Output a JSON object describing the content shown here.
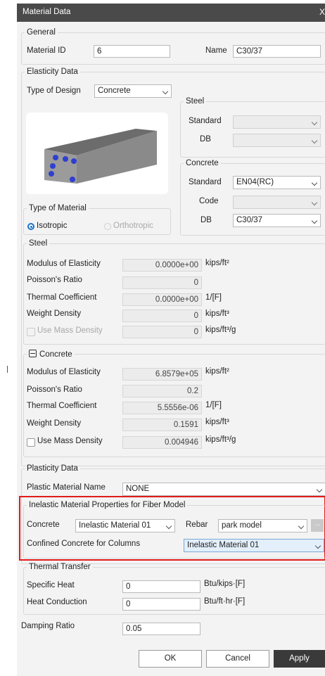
{
  "window": {
    "title": "Material Data",
    "close_label": "X"
  },
  "general": {
    "legend": "General",
    "material_id_label": "Material ID",
    "material_id_value": "6",
    "name_label": "Name",
    "name_value": "C30/37"
  },
  "elasticity": {
    "legend": "Elasticity Data",
    "type_of_design_label": "Type of Design",
    "type_of_design_value": "Concrete",
    "steel_legend": "Steel",
    "steel_standard_label": "Standard",
    "steel_standard_value": "",
    "steel_db_label": "DB",
    "steel_db_value": "",
    "concrete_legend": "Concrete",
    "concrete_standard_label": "Standard",
    "concrete_standard_value": "EN04(RC)",
    "concrete_code_label": "Code",
    "concrete_code_value": "",
    "concrete_db_label": "DB",
    "concrete_db_value": "C30/37",
    "type_of_material_legend": "Type of Material",
    "isotropic_label": "Isotropic",
    "orthotropic_label": "Orthotropic",
    "selected_material_type": "Isotropic"
  },
  "steel_props": {
    "legend": "Steel",
    "modulus_label": "Modulus of Elasticity",
    "modulus_value": "0.0000e+00",
    "modulus_unit": "kips/ft²",
    "poisson_label": "Poisson's Ratio",
    "poisson_value": "0",
    "thermal_label": "Thermal Coefficient",
    "thermal_value": "0.0000e+00",
    "thermal_unit": "1/[F]",
    "weight_label": "Weight Density",
    "weight_value": "0",
    "weight_unit": "kips/ft³",
    "use_mass_label": "Use Mass Density",
    "use_mass_value": "0",
    "use_mass_unit": "kips/ft³/g"
  },
  "concrete_props": {
    "legend": "Concrete",
    "modulus_label": "Modulus of Elasticity",
    "modulus_value": "6.8579e+05",
    "modulus_unit": "kips/ft²",
    "poisson_label": "Poisson's Ratio",
    "poisson_value": "0.2",
    "thermal_label": "Thermal Coefficient",
    "thermal_value": "5.5556e-06",
    "thermal_unit": "1/[F]",
    "weight_label": "Weight Density",
    "weight_value": "0.1591",
    "weight_unit": "kips/ft³",
    "use_mass_label": "Use Mass Density",
    "use_mass_value": "0.004946",
    "use_mass_unit": "kips/ft³/g"
  },
  "plasticity": {
    "legend": "Plasticity Data",
    "plastic_name_label": "Plastic Material Name",
    "plastic_name_value": "NONE"
  },
  "inelastic": {
    "legend": "Inelastic Material Properties for Fiber Model",
    "concrete_label": "Concrete",
    "concrete_value": "Inelastic Material 01",
    "rebar_label": "Rebar",
    "rebar_value": "park model",
    "more_label": "...",
    "confined_label": "Confined Concrete for Columns",
    "confined_value": "Inelastic Material 01"
  },
  "thermal_transfer": {
    "legend": "Thermal Transfer",
    "specific_heat_label": "Specific Heat",
    "specific_heat_value": "0",
    "specific_heat_unit": "Btu/kips·[F]",
    "heat_conduction_label": "Heat Conduction",
    "heat_conduction_value": "0",
    "heat_conduction_unit": "Btu/ft·hr·[F]"
  },
  "damping": {
    "label": "Damping Ratio",
    "value": "0.05"
  },
  "buttons": {
    "ok": "OK",
    "cancel": "Cancel",
    "apply": "Apply"
  },
  "colors": {
    "title_bar": "#4a4a4a",
    "highlight_border": "#e21b1b",
    "accent": "#1a73c9",
    "apply_button": "#3a3a3a"
  }
}
